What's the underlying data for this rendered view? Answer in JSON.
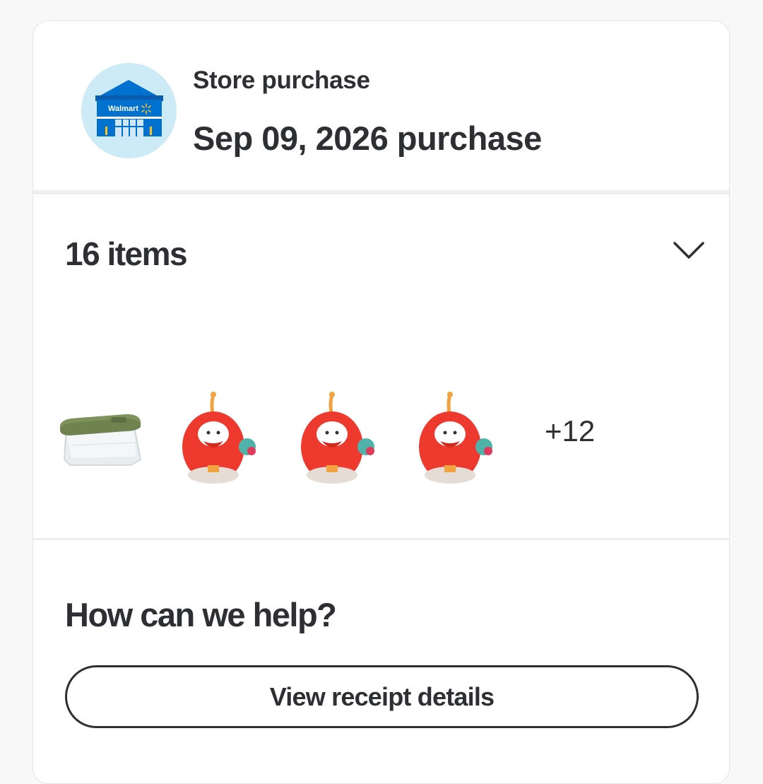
{
  "order": {
    "store_type": "Store purchase",
    "purchase_title": "Sep 09, 2026 purchase",
    "store_icon": "walmart-store-icon",
    "store_logo_text": "Walmart"
  },
  "items": {
    "count_label": "16 items",
    "toggle_icon": "chevron-down-icon",
    "thumbnails": [
      {
        "name": "storage-bin-thumbnail"
      },
      {
        "name": "plush-toy-thumbnail"
      },
      {
        "name": "plush-toy-thumbnail"
      },
      {
        "name": "plush-toy-thumbnail"
      }
    ],
    "more_label": "+12"
  },
  "help": {
    "title": "How can we help?",
    "receipt_button_label": "View receipt details"
  },
  "colors": {
    "text": "#2e2f32",
    "avatar_bg": "#cdeaf7",
    "walmart_blue": "#0071ce",
    "walmart_yellow": "#ffc220"
  }
}
